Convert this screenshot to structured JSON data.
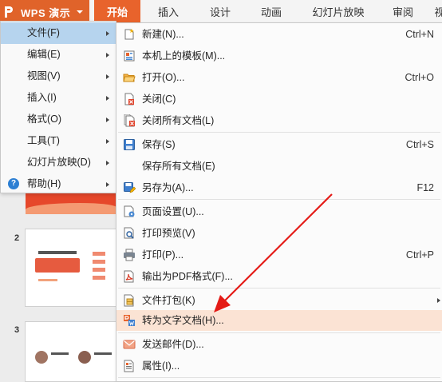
{
  "app": {
    "title": "WPS 演示"
  },
  "tabs": [
    "开始",
    "插入",
    "设计",
    "动画",
    "幻灯片放映",
    "审阅",
    "视"
  ],
  "slide_numbers": [
    "2",
    "3"
  ],
  "left_menu": [
    {
      "label": "文件(F)"
    },
    {
      "label": "编辑(E)"
    },
    {
      "label": "视图(V)"
    },
    {
      "label": "插入(I)"
    },
    {
      "label": "格式(O)"
    },
    {
      "label": "工具(T)"
    },
    {
      "label": "幻灯片放映(D)"
    },
    {
      "label": "帮助(H)"
    }
  ],
  "submenu": [
    {
      "label": "新建(N)...",
      "shortcut": "Ctrl+N",
      "icon": "new-doc-icon"
    },
    {
      "label": "本机上的模板(M)...",
      "shortcut": "",
      "icon": "template-icon"
    },
    {
      "label": "打开(O)...",
      "shortcut": "Ctrl+O",
      "icon": "open-folder-icon"
    },
    {
      "label": "关闭(C)",
      "shortcut": "",
      "icon": "close-doc-icon"
    },
    {
      "label": "关闭所有文档(L)",
      "shortcut": "",
      "icon": "close-all-icon"
    },
    {
      "label": "保存(S)",
      "shortcut": "Ctrl+S",
      "icon": "save-icon"
    },
    {
      "label": "保存所有文档(E)",
      "shortcut": "",
      "icon": ""
    },
    {
      "label": "另存为(A)...",
      "shortcut": "F12",
      "icon": "save-as-icon"
    },
    {
      "label": "页面设置(U)...",
      "shortcut": "",
      "icon": "page-setup-icon"
    },
    {
      "label": "打印预览(V)",
      "shortcut": "",
      "icon": "print-preview-icon"
    },
    {
      "label": "打印(P)...",
      "shortcut": "Ctrl+P",
      "icon": "printer-icon"
    },
    {
      "label": "输出为PDF格式(F)...",
      "shortcut": "",
      "icon": "pdf-icon"
    },
    {
      "label": "文件打包(K)",
      "shortcut": "",
      "icon": "package-icon"
    },
    {
      "label": "转为文字文档(H)...",
      "shortcut": "",
      "icon": "convert-word-icon"
    },
    {
      "label": "发送邮件(D)...",
      "shortcut": "",
      "icon": "mail-icon"
    },
    {
      "label": "属性(I)...",
      "shortcut": "",
      "icon": "properties-icon"
    }
  ],
  "colors": {
    "accent": "#e0632a",
    "highlight": "#fbe3d4",
    "menu_active": "#b6d4ee",
    "arrow": "#e41b17"
  }
}
